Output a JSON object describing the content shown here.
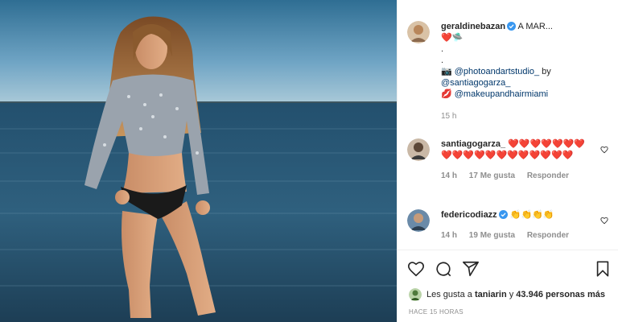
{
  "post": {
    "author": "geraldinebazan",
    "caption_start": "A MAR...",
    "caption_emojis": "❤️🛸",
    "dot1": ".",
    "dot2": ".",
    "camera_emoji": "📷",
    "mention1": "@photoandartstudio_",
    "by_text": " by",
    "mention2": "@santiagogarza_",
    "lips_emoji": "💋",
    "mention3": "@makeupandhairmiami",
    "age": "15 h"
  },
  "comments": [
    {
      "user": "santiagogarza_",
      "text": "❤️❤️❤️❤️❤️❤️❤️❤️❤️❤️❤️❤️❤️❤️❤️❤️❤️❤️❤️",
      "age": "14 h",
      "likes": "17 Me gusta",
      "reply": "Responder"
    },
    {
      "user": "federicodiazz",
      "text": "👏👏👏👏",
      "age": "14 h",
      "likes": "19 Me gusta",
      "reply": "Responder"
    }
  ],
  "likes": {
    "prefix": "Les gusta a",
    "user": "taniarin",
    "middle": "y",
    "count": "43.946 personas más"
  },
  "posted_ago": "HACE 15 HORAS",
  "colors": {
    "verified": "#3897f0",
    "heart": "#ed1c24",
    "link": "#00376b"
  },
  "icons": [
    "heart-icon",
    "comment-icon",
    "share-icon",
    "bookmark-icon",
    "verified-icon"
  ]
}
